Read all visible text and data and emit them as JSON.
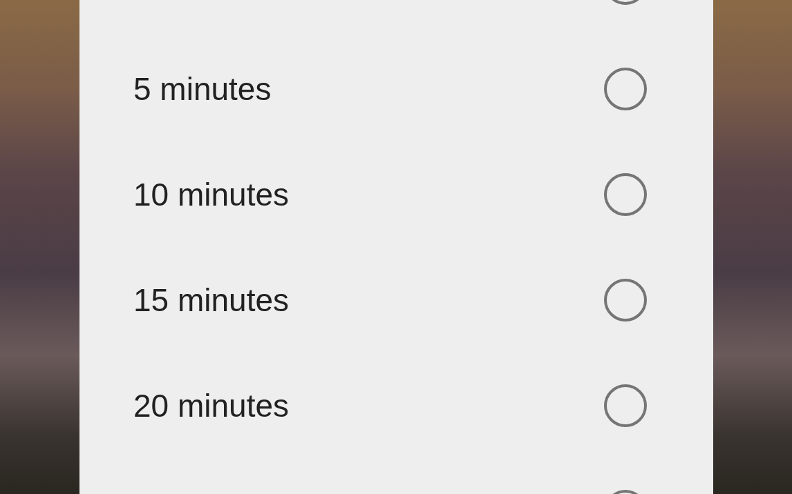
{
  "options": [
    {
      "selected": false
    },
    {
      "label": "5 minutes",
      "selected": false
    },
    {
      "label": "10 minutes",
      "selected": false
    },
    {
      "label": "15 minutes",
      "selected": false
    },
    {
      "label": "20 minutes",
      "selected": false
    },
    {
      "selected": false
    }
  ]
}
